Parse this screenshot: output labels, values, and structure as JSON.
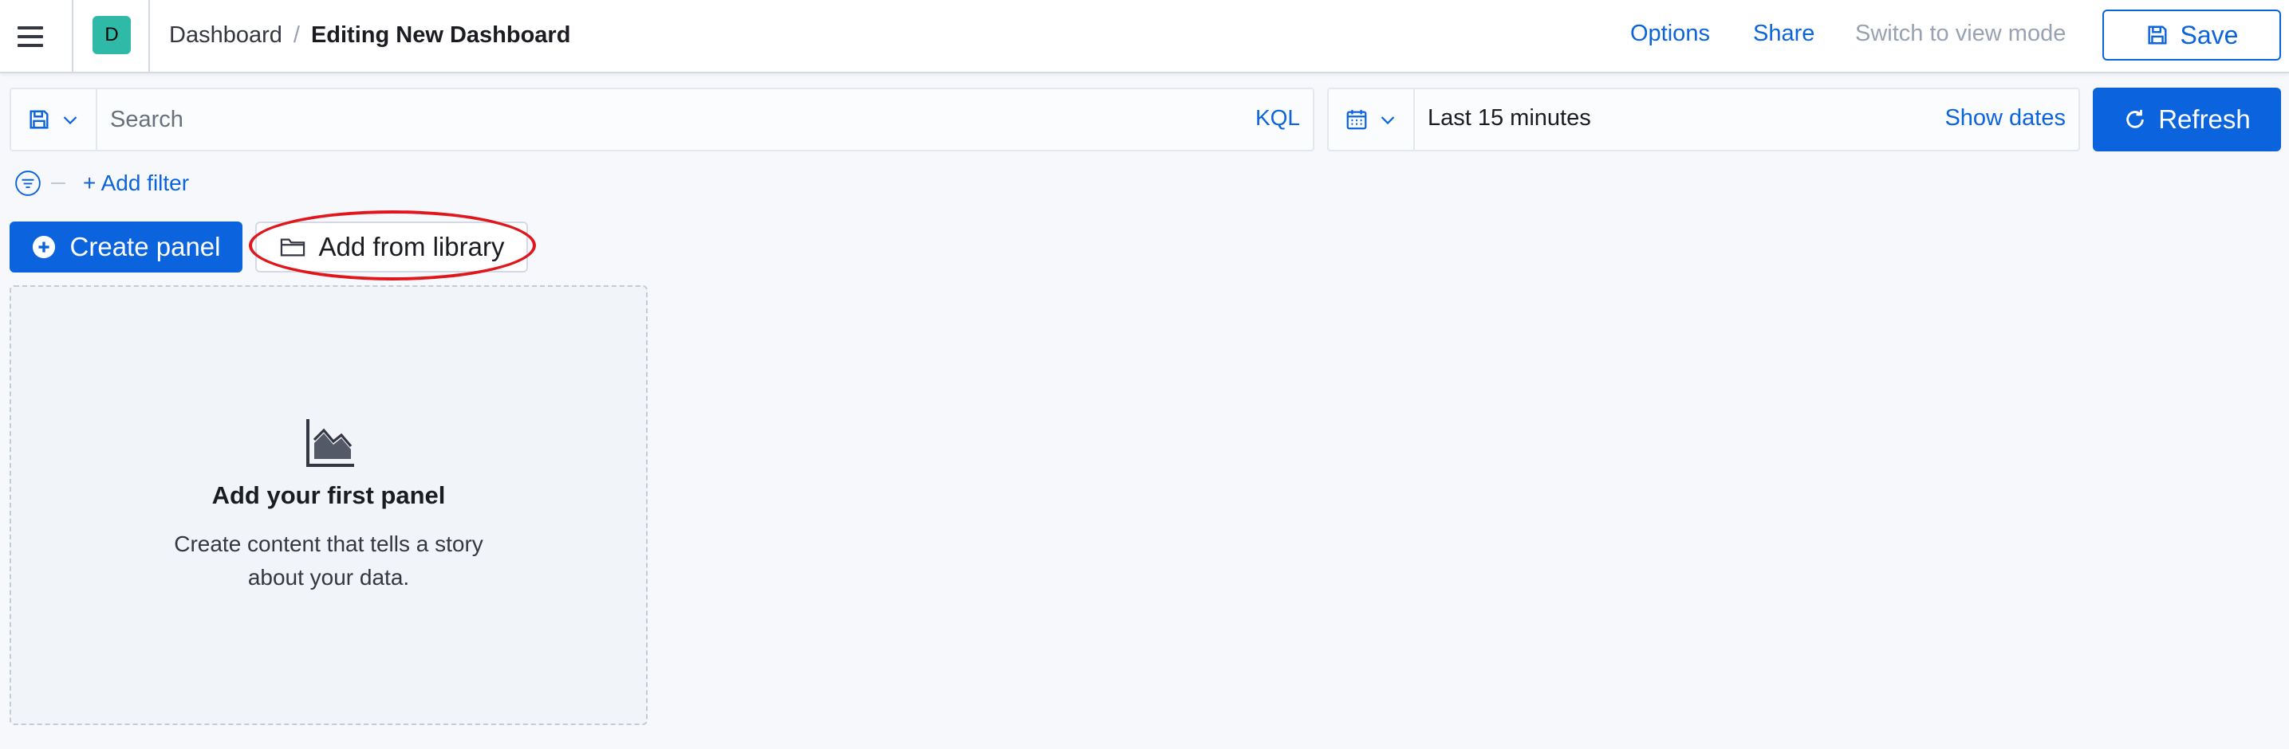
{
  "colors": {
    "accent": "#0b64dd",
    "avatar_bg": "#2fbaa8",
    "annotation": "#e0161b",
    "muted_link": "#98a2b3"
  },
  "header": {
    "avatar_letter": "D",
    "breadcrumbs": [
      "Dashboard",
      "Editing New Dashboard"
    ],
    "options_label": "Options",
    "share_label": "Share",
    "view_mode_label": "Switch to view mode",
    "save_label": "Save"
  },
  "query": {
    "search_placeholder": "Search",
    "search_value": "",
    "language_label": "KQL"
  },
  "date_picker": {
    "range_label": "Last 15 minutes",
    "show_dates_label": "Show dates"
  },
  "refresh_label": "Refresh",
  "filters": {
    "add_filter_label": "+ Add filter"
  },
  "toolbar": {
    "create_panel_label": "Create panel",
    "add_from_library_label": "Add from library"
  },
  "empty_state": {
    "title": "Add your first panel",
    "description": "Create content that tells a story about your data."
  }
}
